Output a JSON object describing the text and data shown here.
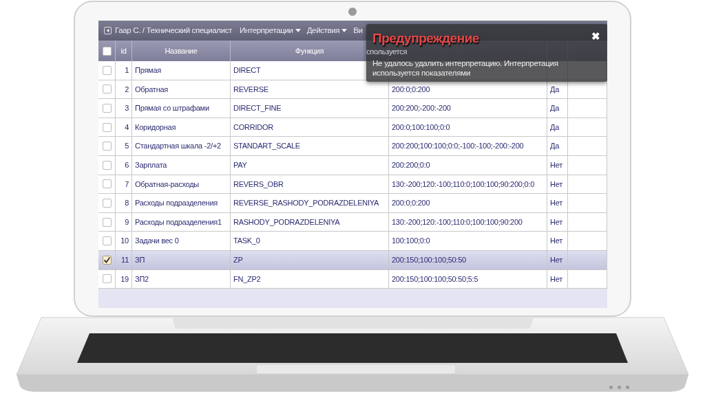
{
  "header": {
    "user": "Гаар С. / Технический специалист",
    "menus": [
      {
        "label": "Интерпретации",
        "caret": true
      },
      {
        "label": "Действия",
        "caret": true
      },
      {
        "label": "Ви",
        "caret": false
      }
    ]
  },
  "table": {
    "all_selected": false,
    "columns": [
      {
        "label": "id"
      },
      {
        "label": "Название"
      },
      {
        "label": "Функция"
      },
      {
        "label": "спользуется"
      }
    ],
    "rows": [
      {
        "id": "1",
        "name": "Прямая",
        "function": "DIRECT",
        "selected": false
      },
      {
        "id": "2",
        "name": "Обратная",
        "function": "REVERSE",
        "value": "200:0;0:200",
        "used": "Да",
        "selected": false
      },
      {
        "id": "3",
        "name": "Прямая со штрафами",
        "function": "DIRECT_FINE",
        "value": "200:200;-200:-200",
        "used": "Да",
        "selected": false
      },
      {
        "id": "4",
        "name": "Коридорная",
        "function": "CORRIDOR",
        "value": "200:0;100:100;0:0",
        "used": "Да",
        "selected": false
      },
      {
        "id": "5",
        "name": "Стандартная шкала -2/+2",
        "function": "STANDART_SCALE",
        "value": "200:200;100:100;0:0;-100:-100;-200:-200",
        "used": "Да",
        "selected": false
      },
      {
        "id": "6",
        "name": "Зарплата",
        "function": "PAY",
        "value": "200:200;0:0",
        "used": "Нет",
        "selected": false
      },
      {
        "id": "7",
        "name": "Обратная-расходы",
        "function": "REVERS_OBR",
        "value": "130:-200;120:-100;110:0;100:100;90:200;0:0",
        "used": "Нет",
        "selected": false
      },
      {
        "id": "8",
        "name": "Расходы подразделения",
        "function": "REVERSE_RASHODY_PODRAZDELENIYA",
        "value": "200:0;0:200",
        "used": "Нет",
        "selected": false
      },
      {
        "id": "9",
        "name": "Расходы подразделения1",
        "function": "RASHODY_PODRAZDELENIYA",
        "value": "130:-200;120:-100;110:0;100:100;90:200",
        "used": "Нет",
        "selected": false
      },
      {
        "id": "10",
        "name": "Задачи вес 0",
        "function": "TASK_0",
        "value": "100:100;0:0",
        "used": "Нет",
        "selected": false
      },
      {
        "id": "11",
        "name": "ЗП",
        "function": "ZP",
        "value": "200:150;100:100;50:50",
        "used": "Нет",
        "selected": true
      },
      {
        "id": "19",
        "name": "ЗП2",
        "function": "FN_ZP2",
        "value": "200:150;100:100;50:50;5:5",
        "used": "Нет",
        "selected": false
      }
    ]
  },
  "toast": {
    "title": "Предупреждение",
    "message": "Не удалось удалить интерпретацию. Интерпретация используется показателями",
    "close": "✖"
  }
}
